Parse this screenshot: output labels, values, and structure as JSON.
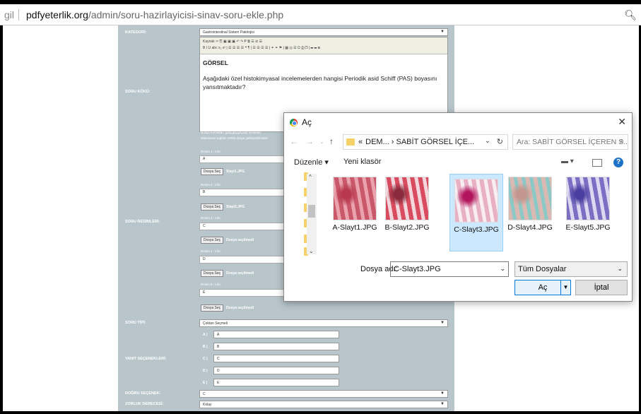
{
  "browser": {
    "tab_fragment": "gil",
    "url_domain": "pdfyeterlik.org",
    "url_path": "/admin/soru-hazirlayicisi-sinav-soru-ekle.php",
    "search_icon": "magnifier-icon"
  },
  "form": {
    "kategori_label": "KATEGORİ:",
    "kategori_value": "Gastrointestinal Sistem Patolojisi",
    "soru_koku_label": "SORU KÖKÜ:",
    "editor_toolbar_1": "Kaynak  ✂ ⎘ ▣ ▣ ▣  ↶ ↷  Ᵽ  ⧉ ☰ ⊘ ☰",
    "editor_toolbar_2": "B  I  U  abc  x₂  x²  |  ☰  ☰  ☰  ☰  ❝  ¶  |  ☰  ☰  ☰  ☰  |  ⚭  ⚭  ⚑  |  ▦  ◎  ☰  Ω  ⎙  ❐  |  ☰  ☰  ⊞",
    "editor_heading": "GÖRSEL",
    "editor_text": "Aşağıdaki özel histokimyasal incelemelerden hangisi Periodik asid Schiff (PAS)  boyasını yansıtmaktadır?",
    "format_note_1": "Dosya formatları 'jpeg,jpg,gif,png' olmalıdır.",
    "format_note_2": "Maksimum toplam 10mb dosya yükleyebilirsiniz.",
    "soru_resimleri_label": "SORU RESİMLERİ:",
    "resim_labels": [
      "Resim 1 : info:",
      "Resim 2 : info:",
      "Resim 3 : info:",
      "Resim 4 : info:",
      "Resim 5 : info:"
    ],
    "resim_values": [
      "A",
      "B",
      "C",
      "D",
      "E"
    ],
    "file_button": "Dosya Seç",
    "file_states": [
      "Slayt1.JPG",
      "Slayt2.JPG",
      "Dosya seçilmedi",
      "Dosya seçilmedi",
      "Dosya seçilmedi"
    ],
    "soru_tipi_label": "SORU TİPİ:",
    "soru_tipi_value": "Çoktan Seçmeli",
    "yanit_label": "YANIT SEÇENEKLERİ:",
    "yanit_letters": [
      "A )",
      "B )",
      "C )",
      "D )",
      "E )"
    ],
    "yanit_values": [
      "A",
      "B",
      "C",
      "D",
      "E"
    ],
    "dogru_label": "DOĞRU SEÇENEK:",
    "dogru_value": "C",
    "zorluk_label": "ZORLUK DERECESİ:",
    "zorluk_value": "Kolay"
  },
  "dialog": {
    "title": "Aç",
    "close": "✕",
    "path_prefix": "«",
    "path": "DEM...  ›  SABİT GÖRSEL İÇE...",
    "search_placeholder": "Ara: SABİT GÖRSEL İÇEREN S...",
    "organize": "Düzenle ▾",
    "new_folder": "Yeni klasör",
    "files": [
      {
        "name": "A-Slayt1.JPG",
        "colors": [
          "#c9586a",
          "#e9a2ae",
          "#b8394f"
        ]
      },
      {
        "name": "B-Slayt2.JPG",
        "colors": [
          "#d94c60",
          "#f3d7dd",
          "#8a2a3c"
        ]
      },
      {
        "name": "C-Slayt3.JPG",
        "colors": [
          "#e8b0c4",
          "#f8eef2",
          "#b3165d"
        ]
      },
      {
        "name": "D-Slayt4.JPG",
        "colors": [
          "#d9b9b2",
          "#8cc9c6",
          "#c4978e"
        ]
      },
      {
        "name": "E-Slayt5.JPG",
        "colors": [
          "#7a6fc2",
          "#ddd8f2",
          "#4c3ea0"
        ]
      }
    ],
    "selected_index": 2,
    "filename_label": "Dosya adı:",
    "filename_value": "C-Slayt3.JPG",
    "filter_value": "Tüm Dosyalar",
    "open_button": "Aç",
    "cancel_button": "İptal"
  }
}
